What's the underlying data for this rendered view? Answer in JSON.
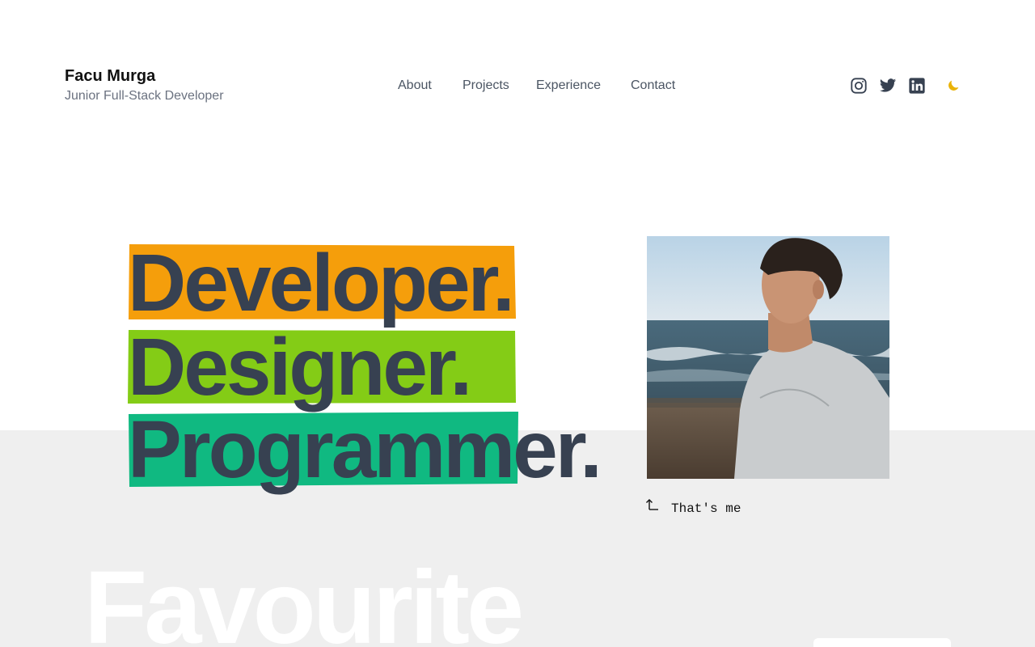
{
  "header": {
    "name": "Facu Murga",
    "role": "Junior Full-Stack Developer"
  },
  "nav": {
    "items": [
      {
        "label": "About"
      },
      {
        "label": "Projects"
      },
      {
        "label": "Experience"
      },
      {
        "label": "Contact"
      }
    ]
  },
  "social": {
    "icons": [
      "instagram-icon",
      "twitter-icon",
      "linkedin-icon"
    ],
    "theme_toggle_icon": "moon-icon"
  },
  "hero": {
    "words": [
      {
        "text": "Developer.",
        "highlight": "#f59e0b"
      },
      {
        "text": "Designer.",
        "highlight": "#84cc16"
      },
      {
        "text": "Programmer.",
        "highlight": "#10b981"
      }
    ],
    "text_color": "#374151"
  },
  "photo": {
    "caption": "That's me"
  },
  "section": {
    "heading": "Favourite"
  },
  "colors": {
    "accent_moon": "#eab308",
    "band": "#efefef"
  }
}
